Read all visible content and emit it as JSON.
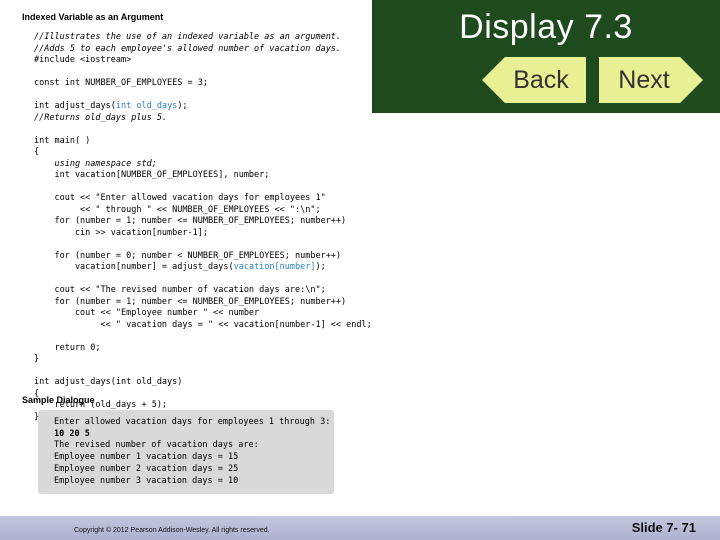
{
  "figure": {
    "title": "Indexed Variable as an Argument"
  },
  "code": {
    "l1": "//Illustrates the use of an indexed variable as an argument.",
    "l2": "//Adds 5 to each employee's allowed number of vacation days.",
    "l3": "#include <iostream>",
    "l4": "const int NUMBER_OF_EMPLOYEES = 3;",
    "l5a": "int adjust_days(",
    "l5b": "int old_days",
    "l5c": ");",
    "l6": "//Returns old_days plus 5.",
    "l7": "int main( )",
    "l8": "{",
    "l9": "    using namespace std;",
    "l10": "    int vacation[NUMBER_OF_EMPLOYEES], number;",
    "l11": "    cout << \"Enter allowed vacation days for employees 1\"",
    "l12": "         << \" through \" << NUMBER_OF_EMPLOYEES << \":\\n\";",
    "l13": "    for (number = 1; number <= NUMBER_OF_EMPLOYEES; number++)",
    "l14": "        cin >> vacation[number-1];",
    "l15": "    for (number = 0; number < NUMBER_OF_EMPLOYEES; number++)",
    "l16a": "        vacation[number] = adjust_days(",
    "l16b": "vacation[number]",
    "l16c": ");",
    "l17": "    cout << \"The revised number of vacation days are:\\n\";",
    "l18": "    for (number = 1; number <= NUMBER_OF_EMPLOYEES; number++)",
    "l19": "        cout << \"Employee number \" << number",
    "l20": "             << \" vacation days = \" << vacation[number-1] << endl;",
    "l21": "    return 0;",
    "l22": "}",
    "l23": "int adjust_days(int old_days)",
    "l24": "{",
    "l25": "    return (old_days + 5);",
    "l26": "}"
  },
  "sample": {
    "heading": "Sample Dialogue",
    "d1": "Enter allowed vacation days for employees 1 through 3:",
    "d2": "10 20 5",
    "d3": "The revised number of vacation days are:",
    "d4": "Employee number 1 vacation days = 15",
    "d5": "Employee number 2 vacation days = 25",
    "d6": "Employee number 3 vacation days = 10"
  },
  "header": {
    "title": "Display 7.3",
    "back_label": "Back",
    "next_label": "Next",
    "bg_color": "#1e4a1e",
    "button_color": "#e9ef93"
  },
  "footer": {
    "copyright": "Copyright © 2012 Pearson Addison-Wesley. All rights reserved.",
    "slide_number": "Slide 7- 71"
  },
  "colors": {
    "highlight": "#2a7fc0",
    "dialogue_bg": "#d9d9d9"
  }
}
